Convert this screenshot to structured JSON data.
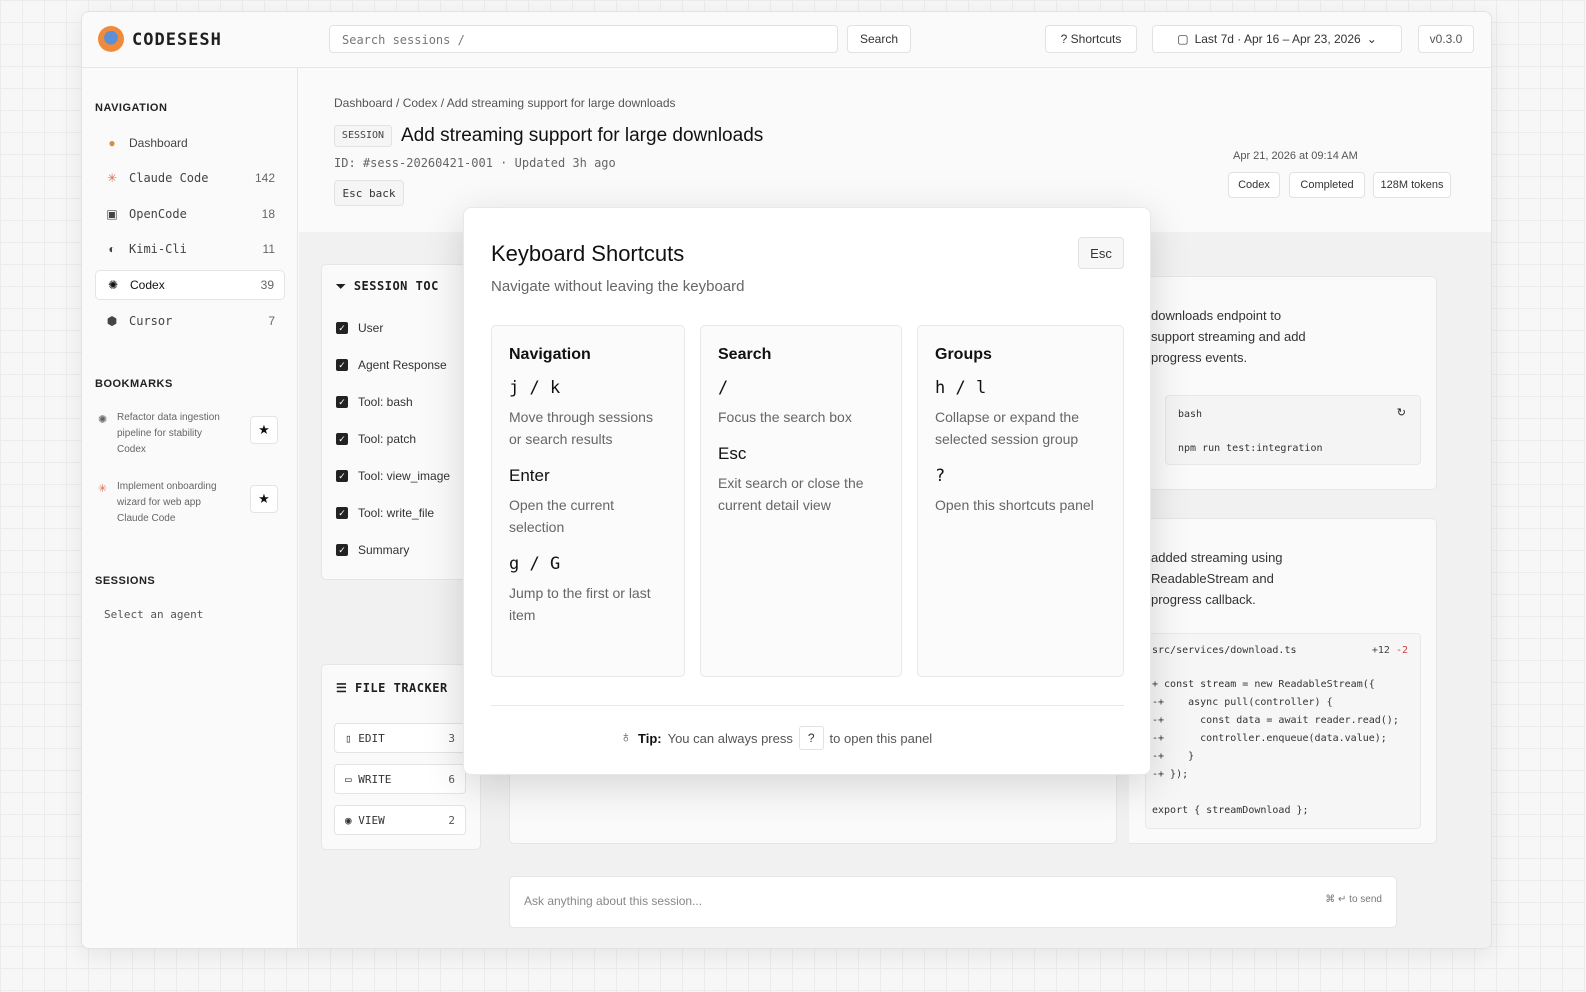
{
  "app": {
    "name": "CODESESH",
    "version": "v0.3.0"
  },
  "topbar": {
    "search_placeholder": "Search  sessions   /",
    "search_button": "Search",
    "shortcuts_button": "?  Shortcuts",
    "range_label": "Last 7d  ·  Apr 16 – Apr 23, 2026"
  },
  "sidebar": {
    "nav_title": "NAVIGATION",
    "items": [
      {
        "label": "Dashboard",
        "count": ""
      },
      {
        "label": "Claude Code",
        "count": "142"
      },
      {
        "label": "OpenCode",
        "count": "18"
      },
      {
        "label": "Kimi-Cli",
        "count": "11"
      },
      {
        "label": "Codex",
        "count": "39"
      },
      {
        "label": "Cursor",
        "count": "7"
      }
    ],
    "bookmarks_title": "BOOKMARKS",
    "bookmarks": [
      {
        "title": "Refactor data ingestion pipeline for stability",
        "agent": "Codex"
      },
      {
        "title": "Implement onboarding wizard for web app",
        "agent": "Claude Code"
      }
    ],
    "sessions_title": "SESSIONS",
    "sessions_empty": "Select  an  agent"
  },
  "session": {
    "breadcrumb": "Dashboard  /  Codex  /  Add streaming support for large downloads",
    "tag": "SESSION",
    "title": "Add streaming support for large downloads",
    "meta": "ID: #sess-20260421-001  ·  Updated 3h ago",
    "back": "Esc back",
    "date": "Apr 21, 2026 at 09:14 AM",
    "badges": [
      "Codex",
      "Completed",
      "128M tokens"
    ]
  },
  "toc": {
    "title": "SESSION TOC",
    "items": [
      "User",
      "Agent Response",
      "Tool:  bash",
      "Tool:  patch",
      "Tool:  view_image",
      "Tool:  write_file",
      "Summary"
    ]
  },
  "tracker": {
    "title": "FILE TRACKER",
    "items": [
      {
        "label": "EDIT",
        "count": "3"
      },
      {
        "label": "WRITE",
        "count": "6"
      },
      {
        "label": "VIEW",
        "count": "2"
      }
    ]
  },
  "messages": {
    "m1_lines": [
      "downloads endpoint to",
      "support streaming and add",
      "progress events."
    ],
    "bash_label": "bash",
    "bash_cmd": "npm run test:integration",
    "m2_lines": [
      "added streaming using",
      "ReadableStream and",
      "progress callback."
    ],
    "diff_file": "src/services/download.ts",
    "diff_add": "+12",
    "diff_del": "-2",
    "diff_lines": [
      "+ const stream = new ReadableStream({",
      "-+    async pull(controller) {",
      "-+      const data = await reader.read();",
      "-+      controller.enqueue(data.value);",
      "-+    }",
      "-+ });",
      "",
      "export { streamDownload };"
    ]
  },
  "ask": {
    "placeholder": "Ask anything about this session...",
    "hint": "⌘ ↵  to send"
  },
  "modal": {
    "title": "Keyboard Shortcuts",
    "subtitle": "Navigate without leaving the keyboard",
    "close": "Esc",
    "columns": [
      {
        "title": "Navigation",
        "rows": [
          {
            "key": "j / k",
            "desc": "Move through sessions or search results"
          },
          {
            "key": "Enter",
            "desc": "Open the current selection"
          },
          {
            "key": "g / G",
            "desc": "Jump to the first or last item"
          }
        ]
      },
      {
        "title": "Search",
        "rows": [
          {
            "key": "/",
            "desc": "Focus the search box"
          },
          {
            "key": "Esc",
            "desc": "Exit search or close the current detail view"
          }
        ]
      },
      {
        "title": "Groups",
        "rows": [
          {
            "key": "h / l",
            "desc": "Collapse or expand the selected session group"
          },
          {
            "key": "?",
            "desc": "Open this shortcuts panel"
          }
        ]
      }
    ],
    "tip_label": "Tip:",
    "tip_text": "You can always press",
    "tip_key": "?",
    "tip_tail": "to open this panel"
  }
}
